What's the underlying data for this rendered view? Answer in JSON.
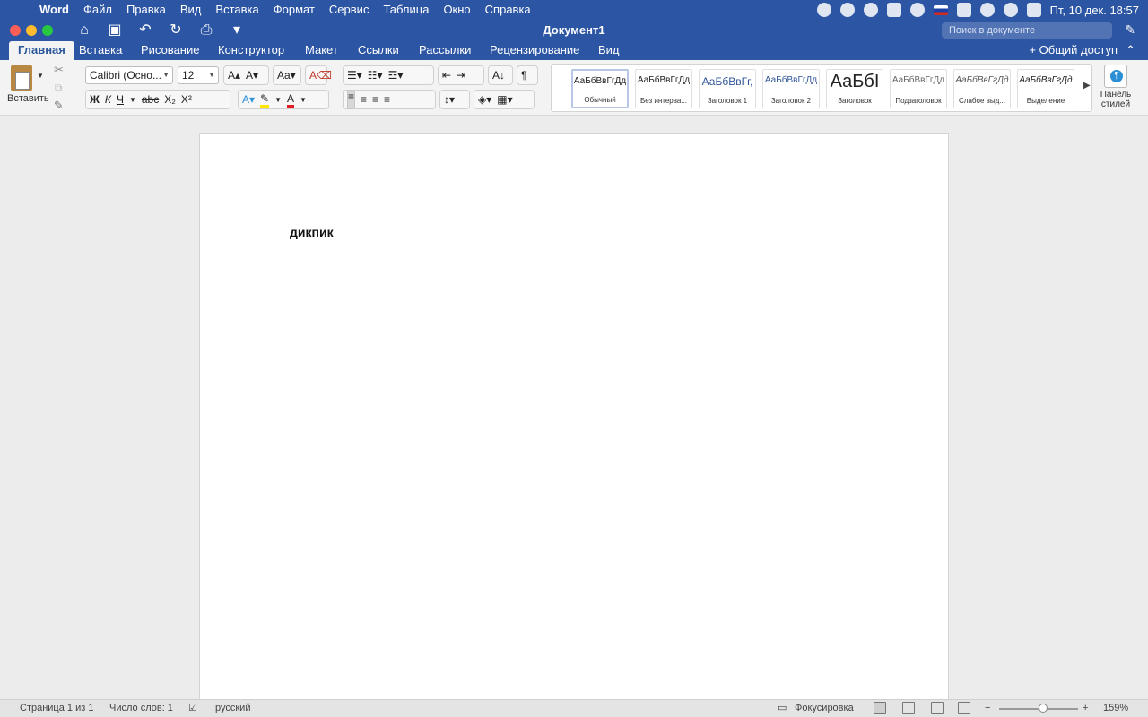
{
  "menubar": {
    "app_name": "Word",
    "items": [
      "Файл",
      "Правка",
      "Вид",
      "Вставка",
      "Формат",
      "Сервис",
      "Таблица",
      "Окно",
      "Справка"
    ],
    "clock": "Пт, 10 дек.  18:57"
  },
  "window": {
    "title": "Документ1",
    "search_placeholder": "Поиск в документе"
  },
  "ribbon": {
    "tabs": [
      "Главная",
      "Вставка",
      "Рисование",
      "Конструктор",
      "Макет",
      "Ссылки",
      "Рассылки",
      "Рецензирование",
      "Вид"
    ],
    "active_tab": "Главная",
    "share_label": "Общий доступ",
    "paste_label": "Вставить",
    "font_name": "Calibri (Осно...",
    "font_size": "12",
    "bold": "Ж",
    "italic": "К",
    "underline": "Ч",
    "strike": "abc",
    "subscript": "X₂",
    "superscript": "X²",
    "styles": [
      {
        "preview": "АаБбВвГгДд",
        "name": "Обычный"
      },
      {
        "preview": "АаБбВвГгДд",
        "name": "Без интерва..."
      },
      {
        "preview": "АаБбВвГг,",
        "name": "Заголовок 1"
      },
      {
        "preview": "АаБбВвГгДд",
        "name": "Заголовок 2"
      },
      {
        "preview": "АаБбІ",
        "name": "Заголовок"
      },
      {
        "preview": "АаБбВвГгДд",
        "name": "Подзаголовок"
      },
      {
        "preview": "АаБбВвГгДд",
        "name": "Слабое выд..."
      },
      {
        "preview": "АаБбВвГгДд",
        "name": "Выделение"
      }
    ],
    "styles_pane_label_1": "Панель",
    "styles_pane_label_2": "стилей"
  },
  "document": {
    "text": "дикпик"
  },
  "statusbar": {
    "page": "Страница 1 из 1",
    "words": "Число слов: 1",
    "language": "русский",
    "focus": "Фокусировка",
    "zoom": "159%",
    "zoom_minus": "−",
    "zoom_plus": "+"
  },
  "colors": {
    "brand_blue": "#2c55a4",
    "highlight_yellow": "#ffe600",
    "font_red": "#e31b23"
  }
}
